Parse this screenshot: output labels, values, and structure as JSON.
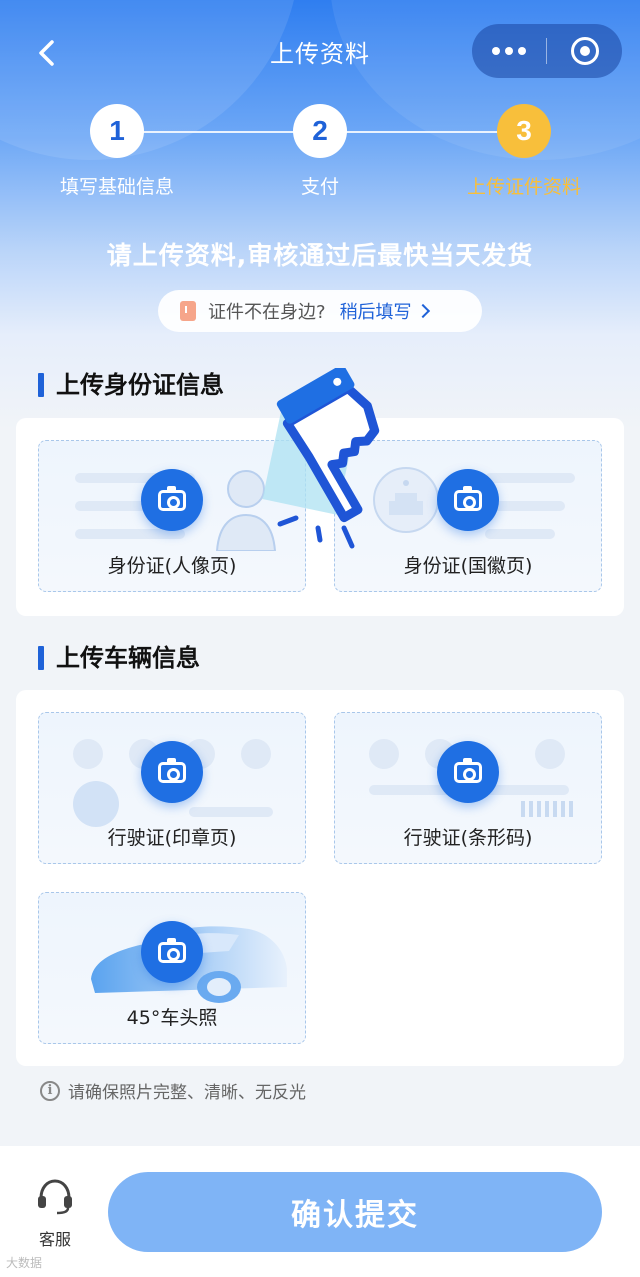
{
  "nav": {
    "title": "上传资料"
  },
  "steps": [
    {
      "num": "1",
      "label": "填写基础信息"
    },
    {
      "num": "2",
      "label": "支付"
    },
    {
      "num": "3",
      "label": "上传证件资料"
    }
  ],
  "headline": "请上传资料,审核通过后最快当天发货",
  "later": {
    "text": "证件不在身边?",
    "link": "稍后填写"
  },
  "id_section": {
    "title": "上传身份证信息",
    "tiles": [
      {
        "label": "身份证(人像页)"
      },
      {
        "label": "身份证(国徽页)"
      }
    ]
  },
  "vehicle_section": {
    "title": "上传车辆信息",
    "tiles": [
      {
        "label": "行驶证(印章页)"
      },
      {
        "label": "行驶证(条形码)"
      },
      {
        "label": "45°车头照"
      }
    ]
  },
  "hint": "请确保照片完整、清晰、无反光",
  "bottom": {
    "service_label": "客服",
    "submit_label": "确认提交"
  },
  "watermark": "大数据",
  "colors": {
    "primary": "#1f62d8",
    "active_step": "#f8bf3b",
    "submit_bg": "#7fb4f6"
  }
}
